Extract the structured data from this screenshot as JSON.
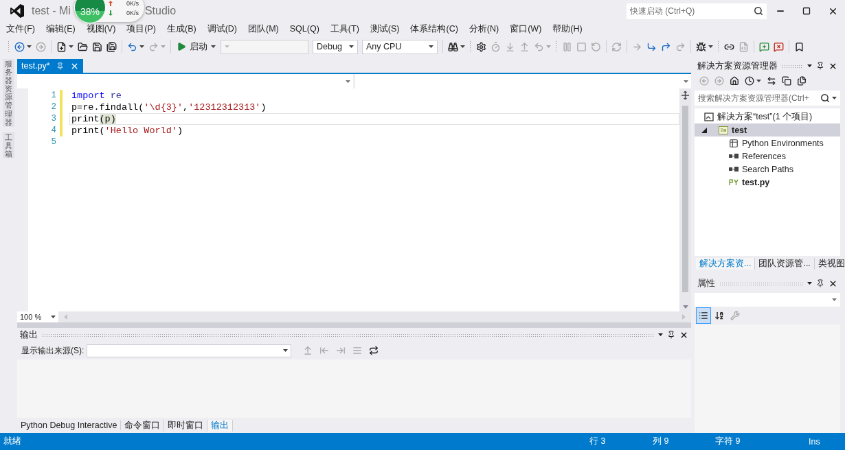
{
  "window": {
    "title_parts": [
      "test - Mi",
      "Studio"
    ],
    "quick_launch": {
      "placeholder": "快速启动 (Ctrl+Q)"
    }
  },
  "net_widget": {
    "percent": "38%",
    "upload": "0K/s",
    "download": "0K/s"
  },
  "menu": [
    {
      "label": "文件(F)"
    },
    {
      "label": "编辑(E)"
    },
    {
      "label": "视图(V)"
    },
    {
      "label": "项目(P)"
    },
    {
      "label": "生成(B)"
    },
    {
      "label": "调试(D)"
    },
    {
      "label": "团队(M)"
    },
    {
      "label": "SQL(Q)"
    },
    {
      "label": "工具(T)"
    },
    {
      "label": "测试(S)"
    },
    {
      "label": "体系结构(C)"
    },
    {
      "label": "分析(N)"
    },
    {
      "label": "窗口(W)"
    },
    {
      "label": "帮助(H)"
    }
  ],
  "toolbar": [
    {
      "kind": "grip"
    },
    {
      "kind": "button",
      "disabled": false,
      "dropdown": true
    },
    {
      "kind": "button",
      "disabled": true,
      "dropdown": false
    },
    {
      "kind": "separator"
    },
    {
      "kind": "button",
      "disabled": false,
      "dropdown": true
    },
    {
      "kind": "button",
      "disabled": false,
      "dropdown": false
    },
    {
      "kind": "button",
      "disabled": false,
      "dropdown": false
    },
    {
      "kind": "button",
      "disabled": false,
      "dropdown": false
    },
    {
      "kind": "separator"
    },
    {
      "kind": "button",
      "disabled": false,
      "dropdown": true
    },
    {
      "kind": "button",
      "disabled": true,
      "dropdown": true
    },
    {
      "kind": "separator"
    },
    {
      "kind": "run",
      "label": "启动",
      "dropdown": true
    },
    {
      "kind": "combo",
      "disabled": true
    },
    {
      "kind": "combo",
      "disabled": false,
      "value": "Debug"
    },
    {
      "kind": "combo",
      "disabled": false,
      "value": "Any CPU"
    },
    {
      "kind": "separator"
    },
    {
      "kind": "button",
      "disabled": false,
      "dropdown": true
    },
    {
      "kind": "grip"
    },
    {
      "kind": "button",
      "disabled": false,
      "dropdown": false
    },
    {
      "kind": "button",
      "disabled": true,
      "dropdown": false
    },
    {
      "kind": "button",
      "disabled": true,
      "dropdown": false
    },
    {
      "kind": "button",
      "disabled": true,
      "dropdown": false
    },
    {
      "kind": "button",
      "disabled": true,
      "dropdown": true
    },
    {
      "kind": "grip"
    },
    {
      "kind": "button",
      "disabled": true,
      "dropdown": false
    },
    {
      "kind": "button",
      "disabled": true,
      "dropdown": false
    },
    {
      "kind": "button",
      "disabled": true,
      "dropdown": false
    },
    {
      "kind": "separator"
    },
    {
      "kind": "button",
      "disabled": true,
      "dropdown": false
    },
    {
      "kind": "separator"
    },
    {
      "kind": "button",
      "disabled": true,
      "dropdown": false
    },
    {
      "kind": "button",
      "disabled": false,
      "dropdown": false
    },
    {
      "kind": "button",
      "disabled": false,
      "dropdown": false
    },
    {
      "kind": "button",
      "disabled": true,
      "dropdown": false
    },
    {
      "kind": "separator"
    },
    {
      "kind": "button",
      "disabled": false,
      "dropdown": true
    },
    {
      "kind": "grip"
    },
    {
      "kind": "button",
      "disabled": false,
      "dropdown": false
    },
    {
      "kind": "button",
      "disabled": true,
      "dropdown": false
    },
    {
      "kind": "separator"
    },
    {
      "kind": "button",
      "disabled": false,
      "dropdown": false
    },
    {
      "kind": "button",
      "disabled": false,
      "dropdown": false
    },
    {
      "kind": "separator"
    },
    {
      "kind": "button",
      "disabled": false,
      "dropdown": false
    }
  ],
  "side_strip": [
    {
      "label": "服务器资源管理器"
    },
    {
      "label": "工具箱"
    }
  ],
  "document_tabs": [
    {
      "label": "test.py*",
      "selected": true
    }
  ],
  "editor": {
    "zoom": "100 %",
    "lines": [
      {
        "number": "1",
        "modified": true,
        "current": false,
        "tokens": [
          {
            "kind": "keyword",
            "text": "import"
          },
          {
            "kind": "module",
            "text": " re"
          }
        ]
      },
      {
        "number": "2",
        "modified": true,
        "current": false,
        "tokens": [
          {
            "kind": "plain",
            "text": "p=re.findall("
          },
          {
            "kind": "string",
            "text": "'\\d{3}'"
          },
          {
            "kind": "plain",
            "text": ","
          },
          {
            "kind": "string",
            "text": "'12312312313'"
          },
          {
            "kind": "plain",
            "text": ")"
          }
        ]
      },
      {
        "number": "3",
        "modified": true,
        "current": true,
        "tokens": [
          {
            "kind": "plain",
            "text": "print"
          },
          {
            "kind": "match",
            "text": "(p)"
          }
        ]
      },
      {
        "number": "4",
        "modified": true,
        "current": false,
        "tokens": [
          {
            "kind": "plain",
            "text": "print("
          },
          {
            "kind": "string",
            "text": "'Hello World'"
          },
          {
            "kind": "plain",
            "text": ")"
          }
        ]
      },
      {
        "number": "5",
        "modified": false,
        "current": false
      }
    ]
  },
  "output": {
    "title": "输出",
    "source_label": "显示输出来源(S):",
    "tools": [
      {
        "disabled": true
      },
      {
        "disabled": true
      },
      {
        "disabled": true
      },
      {
        "disabled": true
      },
      {
        "disabled": false
      }
    ],
    "tabs": [
      {
        "label": "Python Debug Interactive",
        "selected": false
      },
      {
        "label": "命令窗口",
        "selected": false
      },
      {
        "label": "即时窗口",
        "selected": false
      },
      {
        "label": "输出",
        "selected": true
      }
    ]
  },
  "solution_explorer": {
    "title": "解决方案资源管理器",
    "search_placeholder": "搜索解决方案资源管理器(Ctrl+",
    "tools": [
      {
        "disabled": true,
        "dropdown": false
      },
      {
        "disabled": true,
        "dropdown": false
      },
      {
        "disabled": false,
        "dropdown": false
      },
      {
        "disabled": false,
        "dropdown": true
      },
      {
        "disabled": false,
        "dropdown": false
      },
      {
        "disabled": false,
        "dropdown": false
      },
      {
        "disabled": false,
        "dropdown": false
      }
    ],
    "tree": [
      {
        "label": "解决方案“test”(1 个项目)",
        "kind": "solution",
        "selected": false,
        "startup": false,
        "children": [
          {
            "label": "test",
            "kind": "project",
            "selected": true,
            "startup": true,
            "expanded": true,
            "children": [
              {
                "label": "Python Environments",
                "kind": "environments",
                "selected": false,
                "startup": false
              },
              {
                "label": "References",
                "kind": "references",
                "selected": false,
                "startup": false
              },
              {
                "label": "Search Paths",
                "kind": "search_paths",
                "selected": false,
                "startup": false
              },
              {
                "label": "test.py",
                "kind": "file",
                "selected": false,
                "startup": true
              }
            ]
          }
        ]
      }
    ],
    "tabs": [
      {
        "label": "解决方案资...",
        "selected": true
      },
      {
        "label": "团队资源管...",
        "selected": false
      },
      {
        "label": "类视图",
        "selected": false
      }
    ]
  },
  "properties": {
    "title": "属性",
    "tools": [
      {
        "selected": true,
        "disabled": false
      },
      {
        "selected": false,
        "disabled": false
      },
      {
        "selected": false,
        "disabled": true
      }
    ]
  },
  "status_bar": {
    "message": "就绪",
    "line": "行 3",
    "column": "列 9",
    "char": "字符 9",
    "mode": "Ins"
  }
}
